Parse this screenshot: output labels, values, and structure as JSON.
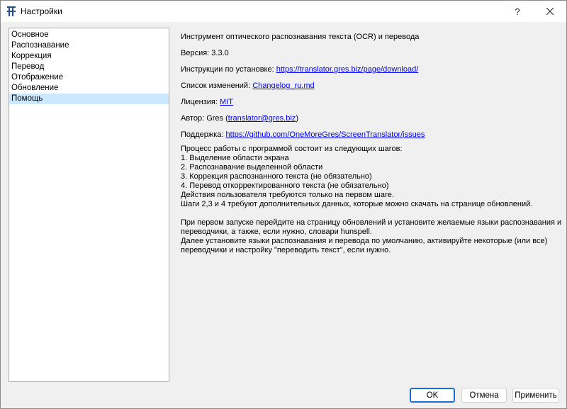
{
  "window": {
    "title": "Настройки",
    "help_label": "?",
    "close_icon": "close-icon"
  },
  "nav": {
    "items": [
      {
        "label": "Основное",
        "selected": false
      },
      {
        "label": "Распознавание",
        "selected": false
      },
      {
        "label": "Коррекция",
        "selected": false
      },
      {
        "label": "Перевод",
        "selected": false
      },
      {
        "label": "Отображение",
        "selected": false
      },
      {
        "label": "Обновление",
        "selected": false
      },
      {
        "label": "Помощь",
        "selected": true
      }
    ]
  },
  "about": {
    "description": "Инструмент оптического распознавания текста (OCR) и перевода",
    "version_label": "Версия:",
    "version": "3.3.0",
    "install_label": "Инструкции по установке:",
    "install_link": "https://translator.gres.biz/page/download/",
    "changelog_label": "Список изменений:",
    "changelog_link": "Changelog_ru.md",
    "license_label": "Лицензия:",
    "license_link": "MIT",
    "author_label": "Автор: Gres (",
    "author_link": "translator@gres.biz",
    "author_close": ")",
    "support_label": "Поддержка:",
    "support_link": "https://github.com/OneMoreGres/ScreenTranslator/issues"
  },
  "process": {
    "lines": [
      "Процесс работы с программой состоит из следующих шагов:",
      "1. Выделение области экрана",
      "2. Распознавание выделенной области",
      "3. Коррекция распознанного текста (не обязательно)",
      "4. Перевод откорректированного текста (не обязательно)",
      "Действия пользователя требуются только на первом шаге.",
      "Шаги 2,3 и 4 требуют дополнительных данных, которые можно скачать на странице обновлений."
    ],
    "first_run_lines": [
      "При первом запуске перейдите на страницу обновлений и установите желаемые языки распознавания и",
      "переводчики, а также, если нужно, словари hunspell.",
      "Далее установите языки распознавания и перевода по умолчанию, активируйте некоторые (или все)",
      "переводчики и настройку \"переводить текст\", если нужно."
    ]
  },
  "buttons": {
    "ok": "OK",
    "cancel": "Отмена",
    "apply": "Применить"
  },
  "colors": {
    "link": "#0000ff",
    "selection": "#cce8ff",
    "default_button_border": "#1a6dd1"
  }
}
